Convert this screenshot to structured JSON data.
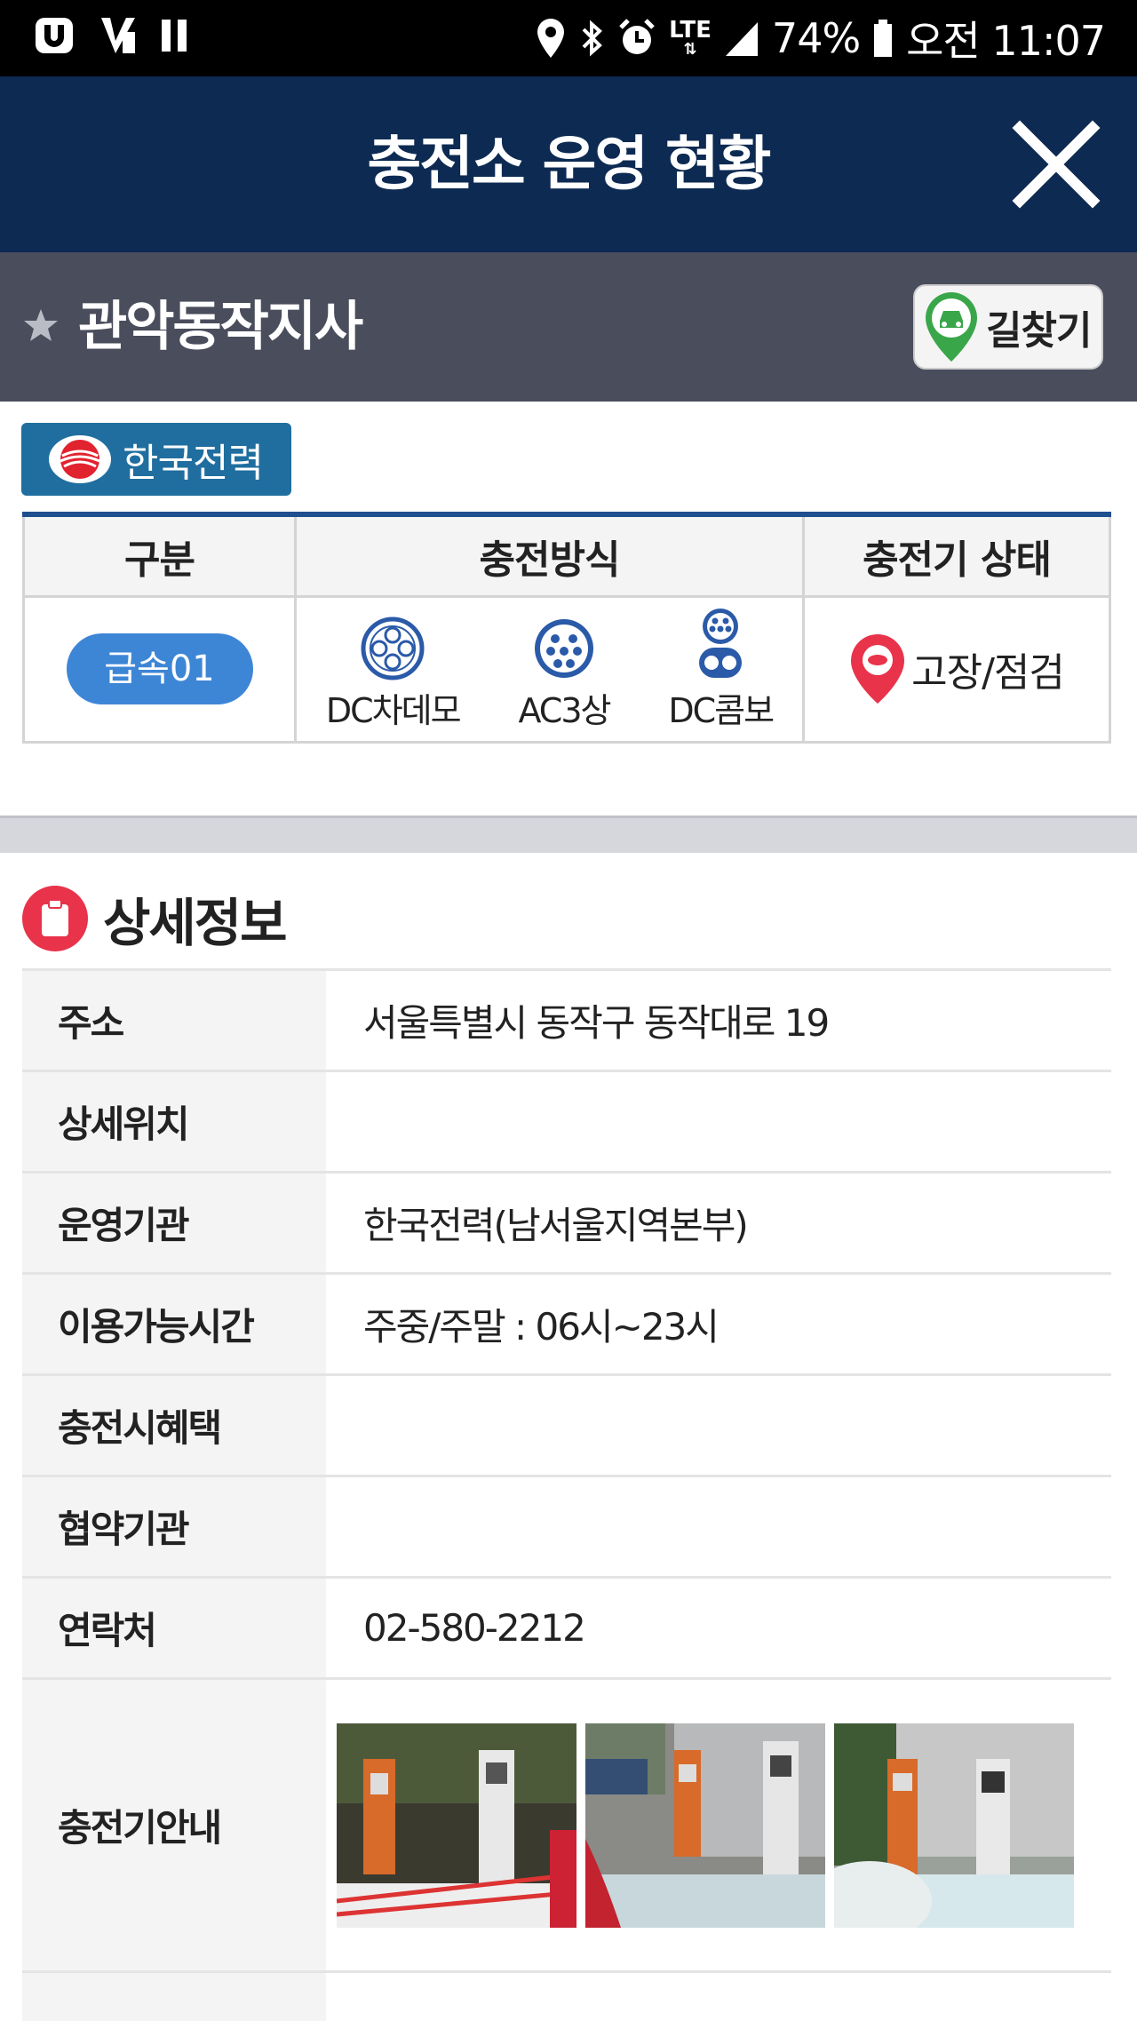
{
  "status_bar": {
    "battery": "74%",
    "network": "LTE",
    "time": "오전 11:07"
  },
  "header": {
    "title": "충전소 운영 현황",
    "close_icon": "close-icon"
  },
  "station": {
    "name": "관악동작지사",
    "route_button": "길찾기"
  },
  "operator": {
    "name": "한국전력"
  },
  "charger_table": {
    "headers": [
      "구분",
      "충전방식",
      "충전기 상태"
    ],
    "rows": [
      {
        "type": "급속01",
        "methods": [
          "DC차데모",
          "AC3상",
          "DC콤보"
        ],
        "status": "고장/점검"
      }
    ]
  },
  "details": {
    "title": "상세정보",
    "rows": [
      {
        "label": "주소",
        "value": "서울특별시 동작구 동작대로 19"
      },
      {
        "label": "상세위치",
        "value": ""
      },
      {
        "label": "운영기관",
        "value": "한국전력(남서울지역본부)"
      },
      {
        "label": "이용가능시간",
        "value": "주중/주말 : 06시~23시"
      },
      {
        "label": "충전시혜택",
        "value": ""
      },
      {
        "label": "협약기관",
        "value": ""
      },
      {
        "label": "연락처",
        "value": "02-580-2212"
      },
      {
        "label": "충전기안내",
        "value": ""
      }
    ]
  },
  "colors": {
    "title_bar": "#0d2a52",
    "station_bar": "#4a4d5c",
    "operator_badge": "#1f6e9f",
    "speed_pill": "#3d86d6",
    "status_marker": "#e8334a",
    "table_top_border": "#1f4f8f"
  }
}
